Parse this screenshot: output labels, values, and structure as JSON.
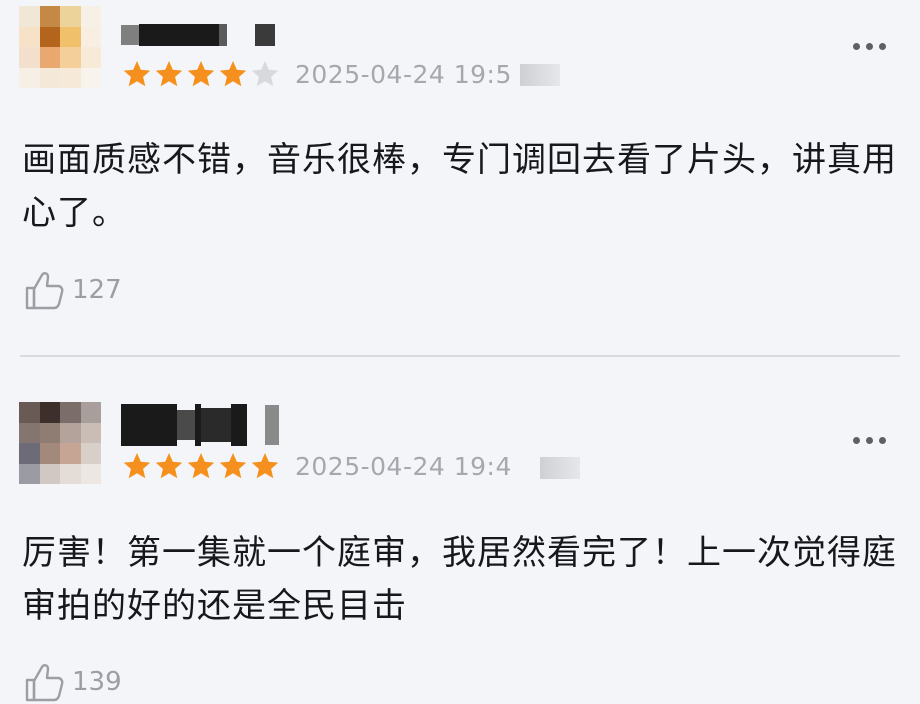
{
  "comments": [
    {
      "date": "2025-04-24 19:5",
      "rating": 4,
      "text": "画面质感不错，音乐很棒，专门调回去看了片头，讲真用心了。",
      "likes": "127",
      "avatar_colors": [
        "#f1e7d6",
        "#c48a45",
        "#ecd39a",
        "#f7f0e6",
        "#f6e2c6",
        "#b3651e",
        "#f0c06a",
        "#f8efe2",
        "#f2e0cc",
        "#e8a870",
        "#f5cf9a",
        "#f7ead7",
        "#f6efe6",
        "#f4e8d8",
        "#f6e9d8",
        "#f8f3ec"
      ]
    },
    {
      "date": "2025-04-24 19:4",
      "rating": 5,
      "text": "厉害！第一集就一个庭审，我居然看完了！上一次觉得庭审拍的好的还是全民目击",
      "likes": "139",
      "avatar_colors": [
        "#6a5a55",
        "#3d302c",
        "#7b6e6a",
        "#a89f9c",
        "#857570",
        "#8f7c72",
        "#b3a39a",
        "#c9bdb6",
        "#6e6b78",
        "#a3897c",
        "#c6a594",
        "#d8cfc9",
        "#9a9ba3",
        "#d1c8c3",
        "#e4dcd6",
        "#ece7e3"
      ]
    }
  ],
  "colors": {
    "star_on": "#f5901e",
    "star_off": "#d8d9dd",
    "text": "#17181b",
    "meta": "#a6a8ae"
  },
  "icons": {
    "like": "thumbs-up-icon",
    "more": "more-dots-icon",
    "star": "star-icon"
  }
}
